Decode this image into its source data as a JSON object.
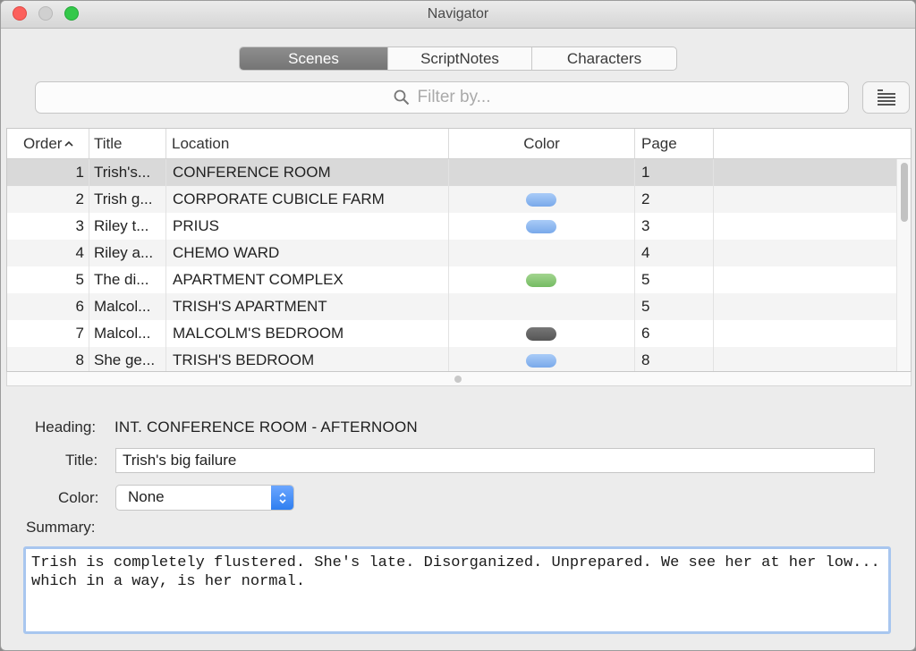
{
  "window": {
    "title": "Navigator"
  },
  "tabs": [
    {
      "label": "Scenes",
      "active": true
    },
    {
      "label": "ScriptNotes",
      "active": false
    },
    {
      "label": "Characters",
      "active": false
    }
  ],
  "filter": {
    "placeholder": "Filter by..."
  },
  "table": {
    "columns": {
      "order": "Order",
      "title": "Title",
      "location": "Location",
      "color": "Color",
      "page": "Page"
    },
    "sort_icon": "chevron-up-icon",
    "rows": [
      {
        "order": "1",
        "title": "Trish's...",
        "location": "CONFERENCE ROOM",
        "color": null,
        "page": "1"
      },
      {
        "order": "2",
        "title": "Trish g...",
        "location": "CORPORATE CUBICLE FARM",
        "color": "blue",
        "page": "2"
      },
      {
        "order": "3",
        "title": "Riley t...",
        "location": "PRIUS",
        "color": "blue",
        "page": "3"
      },
      {
        "order": "4",
        "title": "Riley a...",
        "location": "CHEMO WARD",
        "color": null,
        "page": "4"
      },
      {
        "order": "5",
        "title": "The di...",
        "location": "APARTMENT COMPLEX",
        "color": "green",
        "page": "5"
      },
      {
        "order": "6",
        "title": "Malcol...",
        "location": "TRISH'S APARTMENT",
        "color": null,
        "page": "5"
      },
      {
        "order": "7",
        "title": "Malcol...",
        "location": "MALCOLM'S BEDROOM",
        "color": "gray",
        "page": "6"
      },
      {
        "order": "8",
        "title": "She ge...",
        "location": "TRISH'S BEDROOM",
        "color": "blue",
        "page": "8"
      }
    ]
  },
  "colors": {
    "blue": "#8fb8f2",
    "green": "#8cc879",
    "gray": "#666666"
  },
  "detail": {
    "heading_label": "Heading:",
    "heading_value": "INT. CONFERENCE ROOM - AFTERNOON",
    "title_label": "Title:",
    "title_value": "Trish's big failure",
    "color_label": "Color:",
    "color_value": "None",
    "summary_label": "Summary:",
    "summary_value": "Trish is completely flustered. She's late. Disorganized. Unprepared. We see her at her low... which in a way, is her normal."
  }
}
